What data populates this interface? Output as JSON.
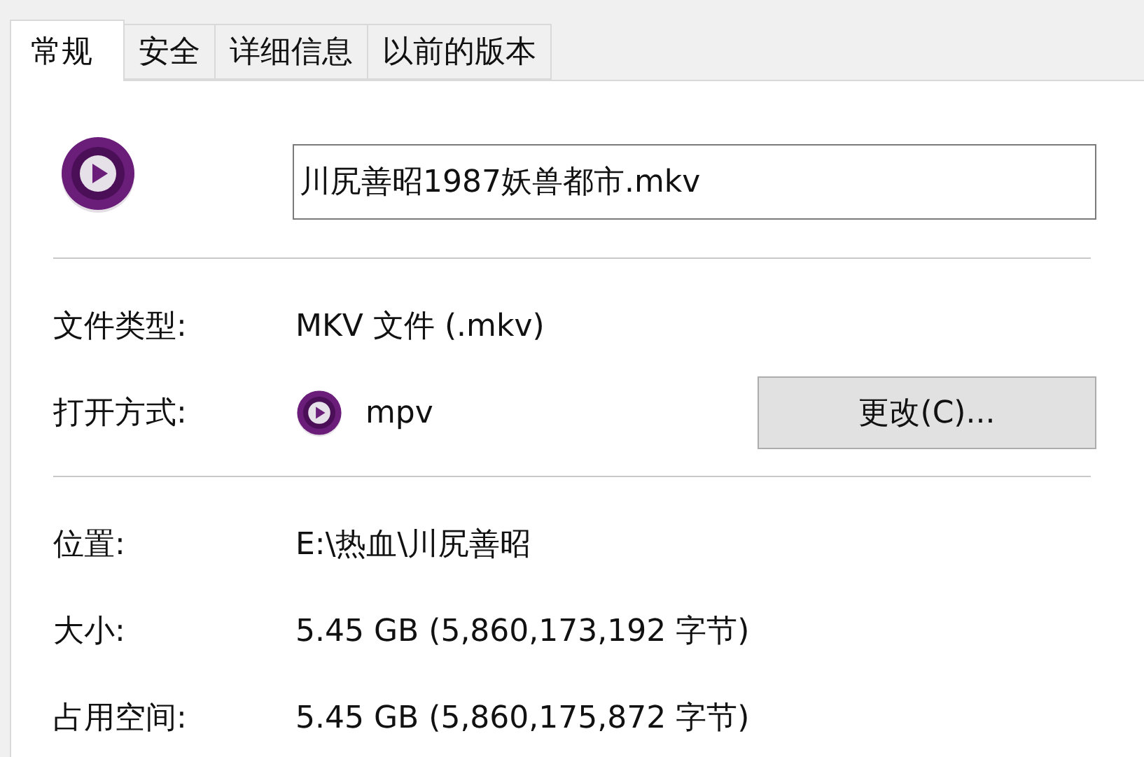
{
  "tabs": [
    {
      "label": "常规",
      "selected": true
    },
    {
      "label": "安全",
      "selected": false
    },
    {
      "label": "详细信息",
      "selected": false
    },
    {
      "label": "以前的版本",
      "selected": false
    }
  ],
  "file_name": "川尻善昭1987妖兽都市.mkv",
  "file_type": {
    "label": "文件类型:",
    "value": "MKV 文件 (.mkv)"
  },
  "opens_with": {
    "label": "打开方式:",
    "app": "mpv",
    "button": "更改(C)..."
  },
  "details": [
    {
      "label": "位置:",
      "value": "E:\\热血\\川尻善昭"
    },
    {
      "label": "大小:",
      "value": "5.45 GB (5,860,173,192 字节)"
    },
    {
      "label": "占用空间:",
      "value": "5.45 GB (5,860,175,872 字节)"
    }
  ]
}
